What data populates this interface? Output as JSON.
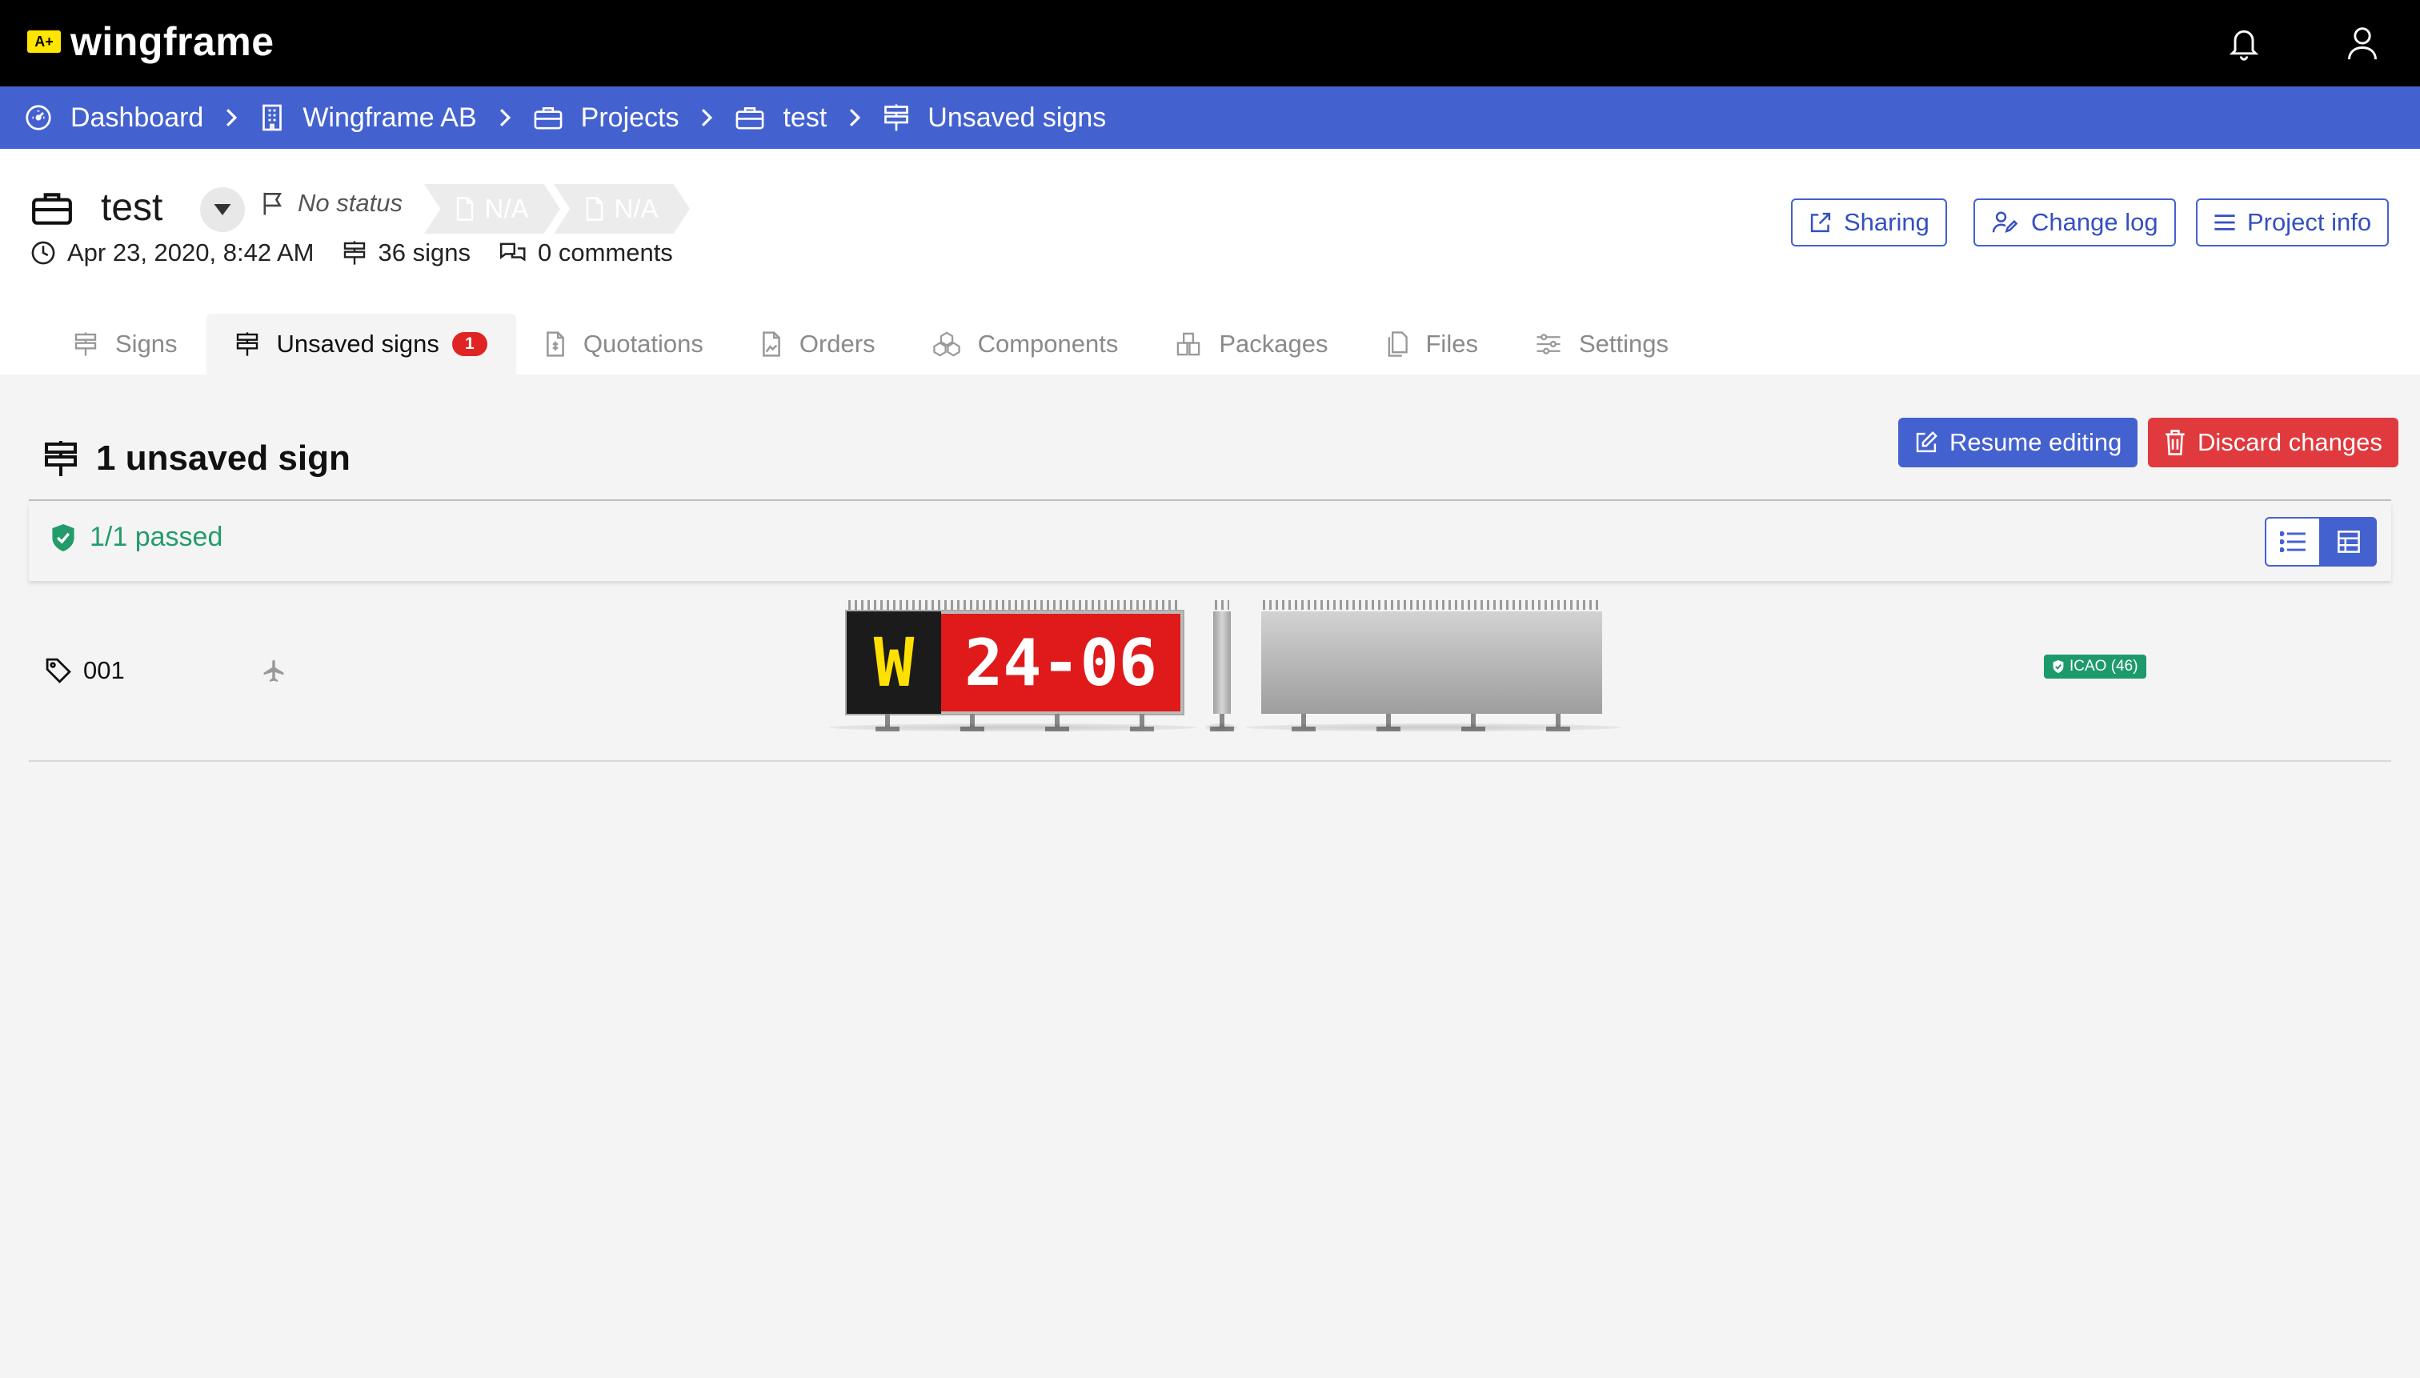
{
  "app": {
    "logo_badge": "A+",
    "logo_text": "wingframe"
  },
  "breadcrumb": [
    {
      "label": "Dashboard",
      "icon": "dashboard-icon"
    },
    {
      "label": "Wingframe AB",
      "icon": "building-icon"
    },
    {
      "label": "Projects",
      "icon": "briefcase-icon"
    },
    {
      "label": "test",
      "icon": "briefcase-icon"
    },
    {
      "label": "Unsaved signs",
      "icon": "signpost-icon"
    }
  ],
  "project": {
    "title": "test",
    "status": "No status",
    "tags": [
      "N/A",
      "N/A"
    ],
    "date": "Apr 23, 2020, 8:42 AM",
    "signs": "36 signs",
    "comments": "0 comments"
  },
  "header_buttons": {
    "sharing": "Sharing",
    "change_log": "Change log",
    "project_info": "Project info"
  },
  "tabs": [
    {
      "label": "Signs",
      "active": false
    },
    {
      "label": "Unsaved signs",
      "active": true,
      "badge": "1"
    },
    {
      "label": "Quotations",
      "active": false
    },
    {
      "label": "Orders",
      "active": false
    },
    {
      "label": "Components",
      "active": false
    },
    {
      "label": "Packages",
      "active": false
    },
    {
      "label": "Files",
      "active": false
    },
    {
      "label": "Settings",
      "active": false
    }
  ],
  "content": {
    "title": "1 unsaved sign",
    "resume": "Resume editing",
    "discard": "Discard changes",
    "passed": "1/1 passed"
  },
  "signs": [
    {
      "id": "001",
      "left_panel": "W",
      "right_panel": "24-06",
      "badge": "ICAO (46)"
    }
  ],
  "colors": {
    "brand_blue": "#4461d0",
    "danger": "#e03a3e",
    "success": "#229c6b",
    "sign_red": "#e01a1a",
    "sign_yellow": "#ffe000"
  }
}
